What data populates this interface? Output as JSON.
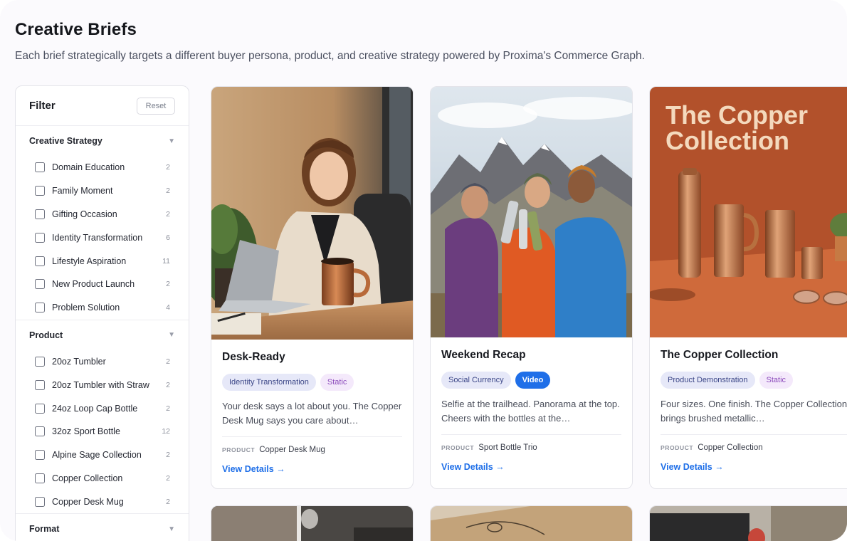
{
  "page": {
    "title": "Creative Briefs",
    "subtitle": "Each brief strategically targets a different buyer persona, product, and creative strategy powered by Proxima's Commerce Graph."
  },
  "filter": {
    "title": "Filter",
    "reset_label": "Reset",
    "groups": [
      {
        "title": "Creative Strategy",
        "options": [
          {
            "label": "Domain Education",
            "count": "2"
          },
          {
            "label": "Family Moment",
            "count": "2"
          },
          {
            "label": "Gifting Occasion",
            "count": "2"
          },
          {
            "label": "Identity Transformation",
            "count": "6"
          },
          {
            "label": "Lifestyle Aspiration",
            "count": "11"
          },
          {
            "label": "New Product Launch",
            "count": "2"
          },
          {
            "label": "Problem Solution",
            "count": "4"
          }
        ]
      },
      {
        "title": "Product",
        "options": [
          {
            "label": "20oz Tumbler",
            "count": "2"
          },
          {
            "label": "20oz Tumbler with Straw",
            "count": "2"
          },
          {
            "label": "24oz Loop Cap Bottle",
            "count": "2"
          },
          {
            "label": "32oz Sport Bottle",
            "count": "12"
          },
          {
            "label": "Alpine Sage Collection",
            "count": "2"
          },
          {
            "label": "Copper Collection",
            "count": "2"
          },
          {
            "label": "Copper Desk Mug",
            "count": "2"
          }
        ]
      },
      {
        "title": "Format",
        "options": []
      }
    ]
  },
  "cards": [
    {
      "title": "Desk-Ready",
      "tags": [
        "Identity Transformation",
        "Static"
      ],
      "description": "Your desk says a lot about you. The Copper Desk Mug says you care about…",
      "product_label": "PRODUCT",
      "product_name": "Copper Desk Mug",
      "cta": "View Details →"
    },
    {
      "title": "Weekend Recap",
      "tags": [
        "Social Currency",
        "Video"
      ],
      "description": "Selfie at the trailhead. Panorama at the top. Cheers with the bottles at the…",
      "product_label": "PRODUCT",
      "product_name": "Sport Bottle Trio",
      "cta": "View Details →"
    },
    {
      "title": "The Copper Collection",
      "tags": [
        "Product Demonstration",
        "Static"
      ],
      "description": "Four sizes. One finish. The Copper Collection brings brushed metallic…",
      "product_label": "PRODUCT",
      "product_name": "Copper Collection",
      "cta": "View Details →",
      "image_headline": "The Copper Collection"
    }
  ],
  "colors": {
    "accent": "#1f6fe8",
    "copper_bg": "#b2512b"
  }
}
